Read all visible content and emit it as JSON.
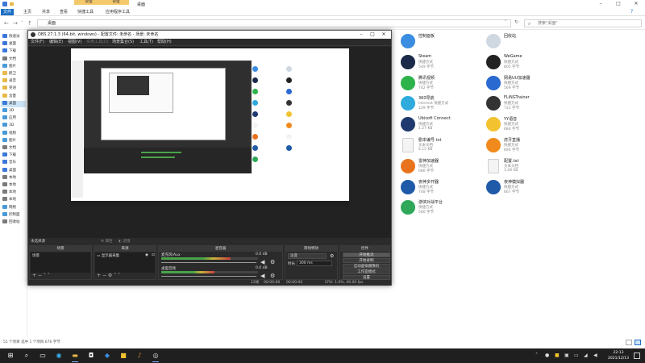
{
  "explorer": {
    "title": "桌面",
    "context_tabs": [
      "管理",
      "管理"
    ],
    "ribbon_tabs": [
      "文件",
      "主页",
      "共享",
      "查看",
      "快捷工具",
      "应用程序工具"
    ],
    "address": "桌面",
    "search_placeholder": "搜索\"桌面\"",
    "nav_items": [
      {
        "label": "快速访",
        "color": "#3b78d8",
        "selected": false
      },
      {
        "label": "桌面",
        "color": "#3b78d8",
        "selected": false
      },
      {
        "label": "下载",
        "color": "#3b78d8",
        "selected": false
      },
      {
        "label": "文档",
        "color": "#7a7a7a",
        "selected": false
      },
      {
        "label": "图片",
        "color": "#4a9ad8",
        "selected": false
      },
      {
        "label": "鹤卫",
        "color": "#e7b84a",
        "selected": false
      },
      {
        "label": "录音",
        "color": "#e7b84a",
        "selected": false
      },
      {
        "label": "英语",
        "color": "#e7b84a",
        "selected": false
      },
      {
        "label": "含量",
        "color": "#e7b84a",
        "selected": false
      },
      {
        "label": "桌面",
        "color": "#3b78d8",
        "selected": true
      },
      {
        "label": "3D",
        "color": "#4a9ad8",
        "selected": false
      },
      {
        "label": "应用",
        "color": "#4a9ad8",
        "selected": false
      },
      {
        "label": "3D",
        "color": "#4a9ad8",
        "selected": false
      },
      {
        "label": "视频",
        "color": "#4a9ad8",
        "selected": false
      },
      {
        "label": "图片",
        "color": "#4a9ad8",
        "selected": false
      },
      {
        "label": "文档",
        "color": "#7a7a7a",
        "selected": false
      },
      {
        "label": "下载",
        "color": "#3b78d8",
        "selected": false
      },
      {
        "label": "音乐",
        "color": "#3b78d8",
        "selected": false
      },
      {
        "label": "桌面",
        "color": "#3b78d8",
        "selected": false
      },
      {
        "label": "本地",
        "color": "#7a7a7a",
        "selected": false
      },
      {
        "label": "本地",
        "color": "#7a7a7a",
        "selected": false
      },
      {
        "label": "本地",
        "color": "#7a7a7a",
        "selected": false
      },
      {
        "label": "本地",
        "color": "#7a7a7a",
        "selected": false
      },
      {
        "label": "网络",
        "color": "#4a9ad8",
        "selected": false
      },
      {
        "label": "控制面",
        "color": "#4a9ad8",
        "selected": false
      },
      {
        "label": "回收站",
        "color": "#7a7a7a",
        "selected": false
      }
    ],
    "status": "51 个项目   选中 1 个项目  676 字节"
  },
  "desktop_items": [
    {
      "name": "控制面板",
      "sub": "",
      "sub2": "",
      "color": "#3a8de0",
      "col": 0,
      "doc": false
    },
    {
      "name": "回收站",
      "sub": "",
      "sub2": "",
      "color": "#cfd8e0",
      "col": 1,
      "doc": false
    },
    {
      "name": "Steam",
      "sub": "快捷方式",
      "sub2": "549 字节",
      "color": "#1b2a49",
      "col": 0,
      "doc": false
    },
    {
      "name": "WeGame",
      "sub": "快捷方式",
      "sub2": "805 字节",
      "color": "#222222",
      "col": 1,
      "doc": false
    },
    {
      "name": "腾讯视频",
      "sub": "快捷方式",
      "sub2": "742 字节",
      "color": "#2db34a",
      "col": 0,
      "doc": false
    },
    {
      "name": "网易UU加速器",
      "sub": "快捷方式",
      "sub2": "569 字节",
      "color": "#2a6ad0",
      "col": 1,
      "doc": false
    },
    {
      "name": "360导航",
      "sub": "Internet 快捷方式",
      "sub2": "129 字节",
      "color": "#2eaadc",
      "col": 0,
      "doc": false
    },
    {
      "name": "FLiNGTrainer",
      "sub": "快捷方式",
      "sub2": "722 字节",
      "color": "#333333",
      "col": 1,
      "doc": false
    },
    {
      "name": "Ubisoft Connect",
      "sub": "快捷方式",
      "sub2": "1.27 KB",
      "color": "#1f3a6e",
      "col": 0,
      "doc": false
    },
    {
      "name": "YY语音",
      "sub": "快捷方式",
      "sub2": "684 字节",
      "color": "#f2c230",
      "col": 1,
      "doc": false
    },
    {
      "name": "剧本编号.txt",
      "sub": "文本文档",
      "sub2": "4.15 KB",
      "color": "#f4f4f4",
      "col": 0,
      "doc": true
    },
    {
      "name": "虎牙直播",
      "sub": "快捷方式",
      "sub2": "694 字节",
      "color": "#f08a1c",
      "col": 1,
      "doc": false
    },
    {
      "name": "雷神加速器",
      "sub": "快捷方式",
      "sub2": "686 字节",
      "color": "#e8731c",
      "col": 0,
      "doc": false
    },
    {
      "name": "配置.txt",
      "sub": "文本文档",
      "sub2": "3.28 KB",
      "color": "#f4f4f4",
      "col": 1,
      "doc": true
    },
    {
      "name": "夜神多开器",
      "sub": "快捷方式",
      "sub2": "748 字节",
      "color": "#1f5aa8",
      "col": 0,
      "doc": false
    },
    {
      "name": "夜神模拟器",
      "sub": "快捷方式",
      "sub2": "667 字节",
      "color": "#1f5aa8",
      "col": 1,
      "doc": false
    },
    {
      "name": "游侠对战平台",
      "sub": "快捷方式",
      "sub2": "566 字节",
      "color": "#2fa85a",
      "col": 0,
      "doc": false
    }
  ],
  "obs": {
    "title": "OBS 27.1.3 (64-bit, windows) - 配置文件: 未命名 - 场景: 未命名",
    "menu": [
      "文件(F)",
      "编辑(E)",
      "视图(V)",
      "实用工具(D)",
      "场景集合(S)",
      "工具(T)",
      "帮助(H)"
    ],
    "scenebar": [
      "未选择源",
      "属性",
      "滤镜"
    ],
    "docks": {
      "scenes": {
        "title": "场景",
        "items": [
          "场景"
        ]
      },
      "sources": {
        "title": "来源",
        "items": [
          "显示器采集"
        ]
      },
      "mixer": {
        "title": "混音器",
        "channels": [
          {
            "name": "麦克风/Aux",
            "db": "0.0 dB",
            "level": 0.72
          },
          {
            "name": "桌面音频",
            "db": "0.0 dB",
            "level": 0.55
          }
        ]
      },
      "transitions": {
        "title": "转场特效",
        "type": "淡变",
        "duration_label": "时长",
        "duration": "300 ms"
      },
      "controls": {
        "title": "控件",
        "buttons": [
          "开始推流",
          "开始录制",
          "启动虚拟摄像机",
          "工作室模式",
          "设置",
          "退出"
        ]
      }
    },
    "status": {
      "dropped": "LIVE: 00:00:00",
      "rec": "REC: 00:00:00",
      "cpu": "CPU: 1.0%, 40.00 fps",
      "bitrate": "12帧",
      "time1": "00:00:00",
      "time2": "00:00:00"
    }
  },
  "taskbar": {
    "time": "22:13",
    "date": "2021/12/13"
  }
}
